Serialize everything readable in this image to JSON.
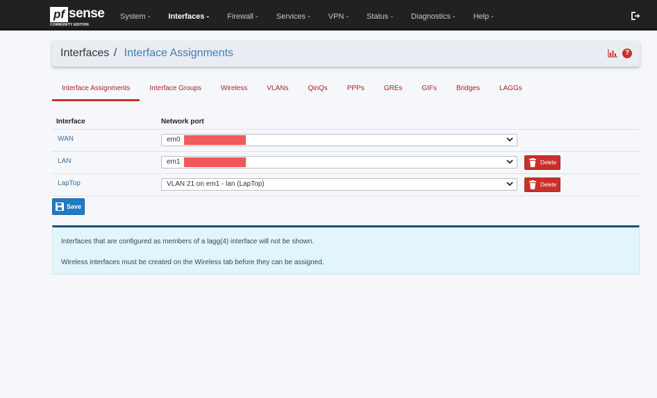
{
  "brand": {
    "logo_pf": "pf",
    "logo_sense": "sense",
    "edition": "COMMUNITY EDITION"
  },
  "nav": {
    "items": [
      {
        "label": "System -"
      },
      {
        "label": "Interfaces -"
      },
      {
        "label": "Firewall -"
      },
      {
        "label": "Services -"
      },
      {
        "label": "VPN -"
      },
      {
        "label": "Status -"
      },
      {
        "label": "Diagnostics -"
      },
      {
        "label": "Help -"
      }
    ],
    "active_index": 1
  },
  "breadcrumb": {
    "parent": "Interfaces",
    "separator": "/",
    "current": "Interface Assignments"
  },
  "tabs": [
    {
      "label": "Interface Assignments"
    },
    {
      "label": "Interface Groups"
    },
    {
      "label": "Wireless"
    },
    {
      "label": "VLANs"
    },
    {
      "label": "QinQs"
    },
    {
      "label": "PPPs"
    },
    {
      "label": "GREs"
    },
    {
      "label": "GIFs"
    },
    {
      "label": "Bridges"
    },
    {
      "label": "LAGGs"
    }
  ],
  "table": {
    "headers": {
      "interface": "Interface",
      "network_port": "Network port"
    },
    "rows": [
      {
        "interface": "WAN",
        "port": "em0",
        "redacted": true
      },
      {
        "interface": "LAN",
        "port": "em1",
        "redacted": true,
        "delete_label": "Delete"
      },
      {
        "interface": "LapTop",
        "port": "VLAN 21 on em1 - lan (LapTop)",
        "redacted": false,
        "delete_label": "Delete"
      }
    ]
  },
  "save_label": "Save",
  "info": {
    "line1": "Interfaces that are configured as members of a lagg(4) interface will not be shown.",
    "line2": "Wireless interfaces must be created on the Wireless tab before they can be assigned."
  },
  "colors": {
    "navbar": "#1f2123",
    "link_red": "#a5262a",
    "delete_red": "#c9302c",
    "primary_blue": "#1e7bc8",
    "info_bg": "#e1f5fb",
    "redaction": "#f05a5a"
  }
}
